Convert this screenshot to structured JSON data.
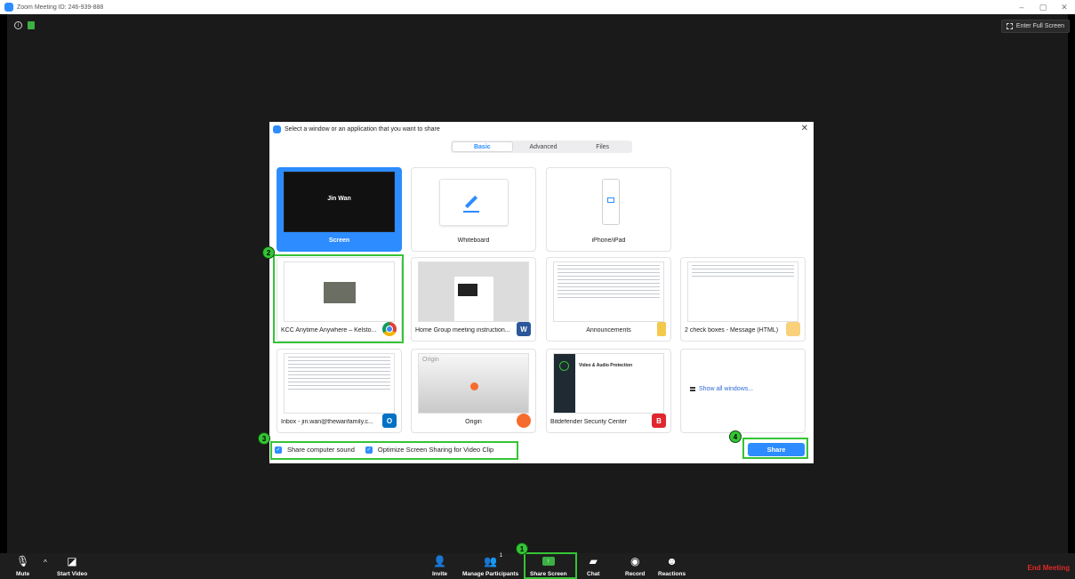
{
  "window": {
    "title": "Zoom Meeting ID: 246-939-888",
    "minimize": "–",
    "restore": "▢",
    "close": "✕"
  },
  "top_bar": {
    "info_icon": "i",
    "enter_fullscreen": "Enter Full Screen"
  },
  "dialog": {
    "title": "Select a window or an application that you want to share",
    "close": "✕",
    "tabs": [
      {
        "label": "Basic",
        "active": true
      },
      {
        "label": "Advanced",
        "active": false
      },
      {
        "label": "Files",
        "active": false
      }
    ],
    "tiles": [
      {
        "label": "Screen",
        "thumb_text": "Jin Wan",
        "selected": true
      },
      {
        "label": "Whiteboard"
      },
      {
        "label": "iPhone/iPad"
      },
      {
        "label": "KCC Anytime Anywhere – Kelsto...",
        "icon": "chrome-icon"
      },
      {
        "label": "Home Group meeting instruction...",
        "icon": "word-icon",
        "badge": "W"
      },
      {
        "label": "Announcements",
        "icon": "folder-icon"
      },
      {
        "label": "2 check boxes - Message (HTML)",
        "icon": "mail-icon"
      },
      {
        "label": "Inbox - jin.wan@thewanfamily.c...",
        "icon": "outlook-icon",
        "badge": "O"
      },
      {
        "label": "Origin",
        "thumb_text": "Origin",
        "icon": "origin-icon"
      },
      {
        "label": "Bitdefender Security Center",
        "thumb_text": "Video & Audio Protection",
        "icon": "bitdefender-icon",
        "badge": "B"
      }
    ],
    "show_all": "Show all windows...",
    "share_sound": "Share computer sound",
    "optimize": "Optimize Screen Sharing for Video Clip",
    "share_button": "Share"
  },
  "annotations": [
    "1",
    "2",
    "3",
    "4"
  ],
  "toolbar": {
    "mute": "Mute",
    "start_video": "Start Video",
    "invite": "Invite",
    "manage_participants": "Manage Participants",
    "participant_count": "1",
    "share_screen": "Share Screen",
    "chat": "Chat",
    "record": "Record",
    "reactions": "Reactions",
    "end_meeting": "End Meeting"
  },
  "colors": {
    "accent": "#2d8cff",
    "highlight": "#35c435",
    "end_meeting": "#e02828"
  }
}
